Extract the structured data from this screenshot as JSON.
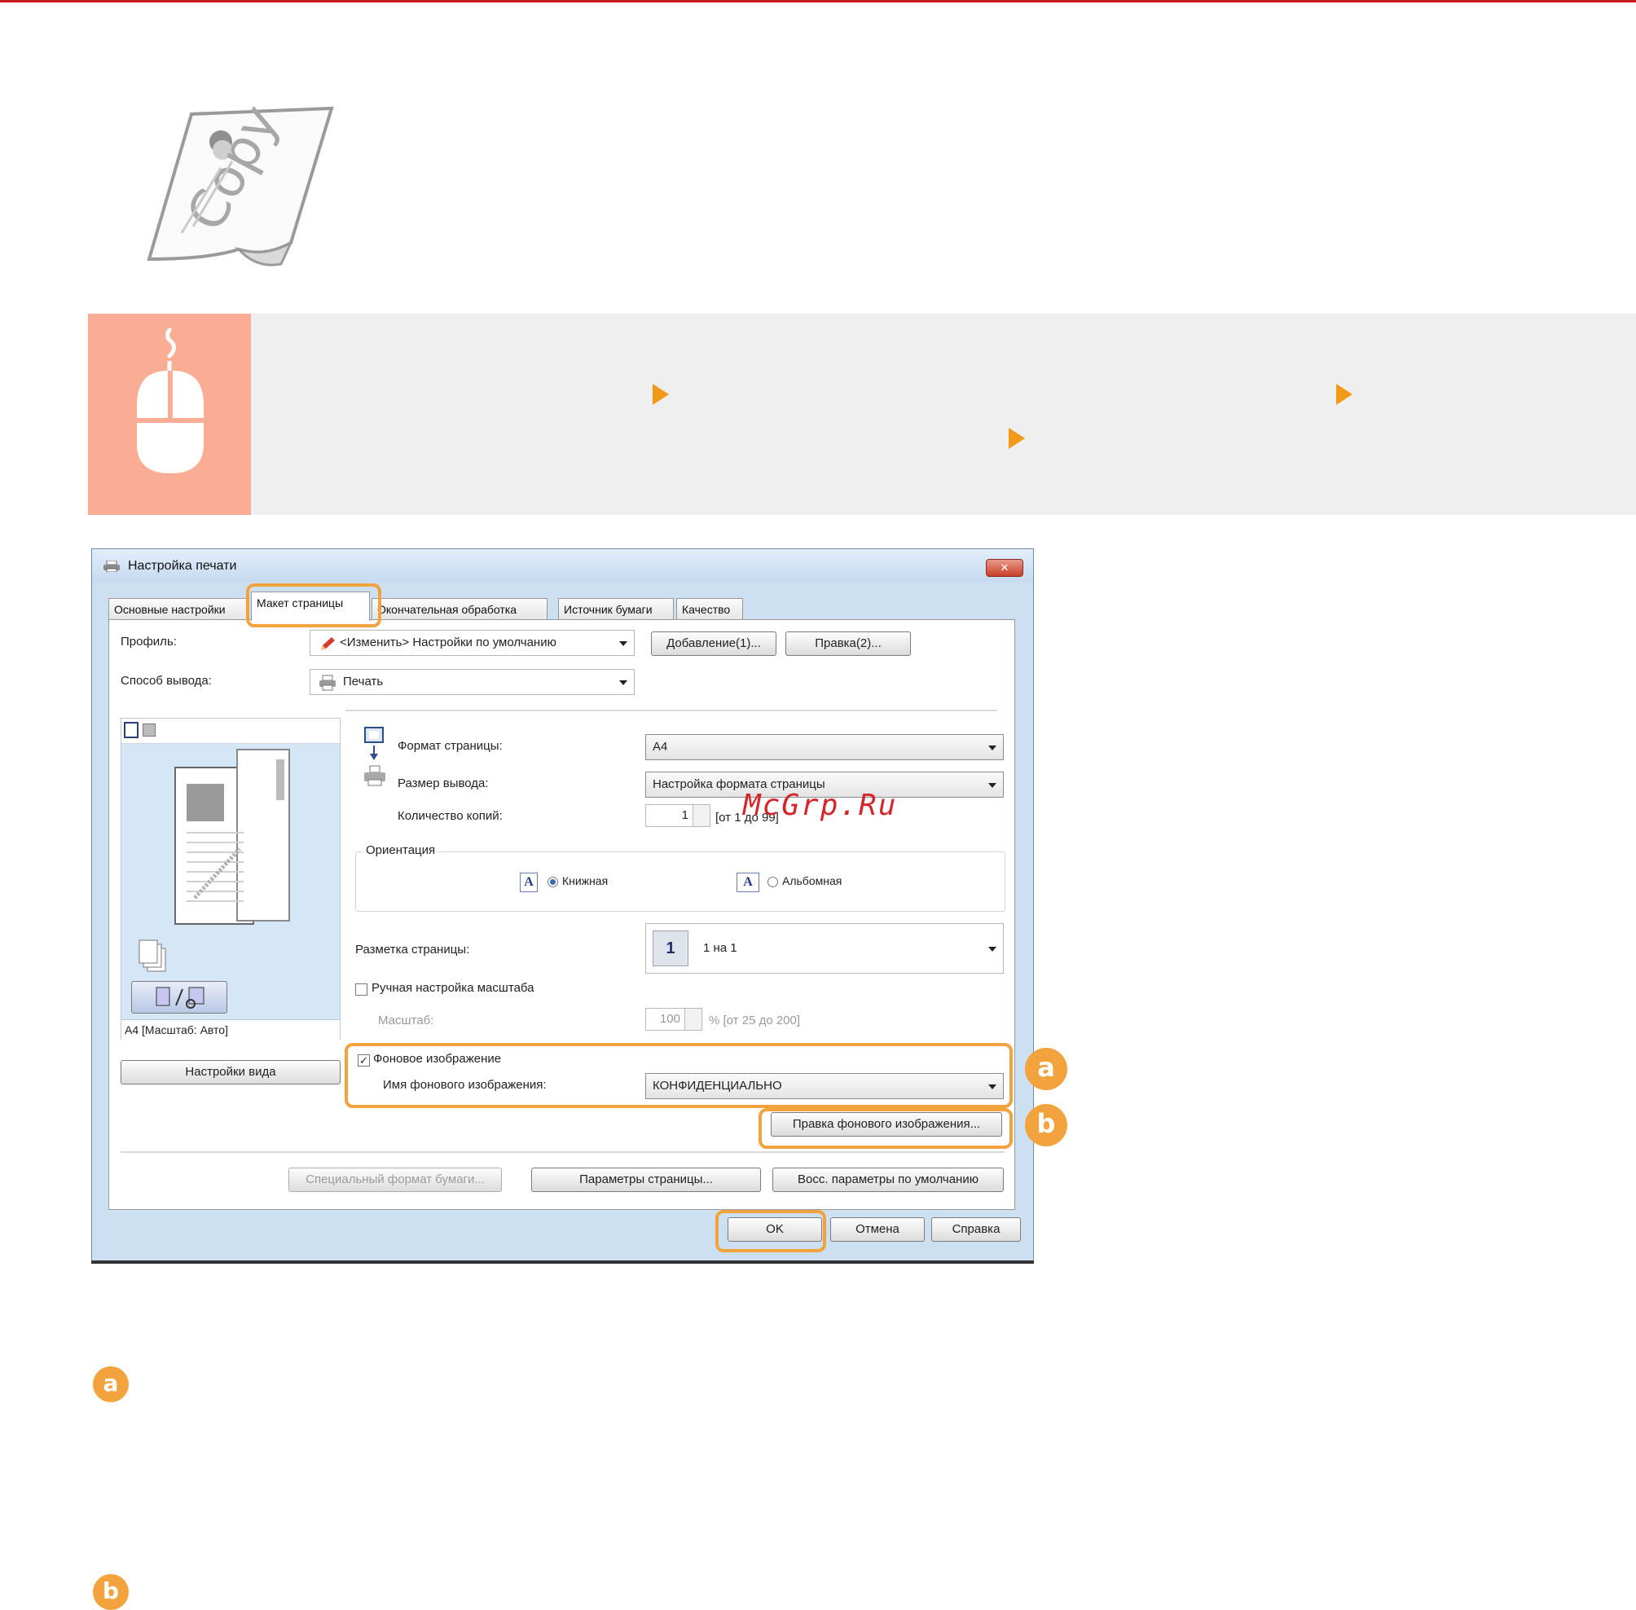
{
  "dialog": {
    "title": "Настройка печати",
    "close_label": "✕",
    "tabs": [
      "Основные настройки",
      "Макет страницы",
      "Окончательная обработка",
      "Источник бумаги",
      "Качество"
    ],
    "profile_label": "Профиль:",
    "profile_value": "<Изменить> Настройки по умолчанию",
    "add_button": "Добавление(1)...",
    "edit_button": "Правка(2)...",
    "output_label": "Способ вывода:",
    "output_value": "Печать",
    "preview_caption": "A4 [Масштаб: Авто]",
    "view_settings_button": "Настройки вида",
    "page_size_label": "Формат страницы:",
    "page_size_value": "A4",
    "output_size_label": "Размер вывода:",
    "output_size_value": "Настройка формата страницы",
    "copies_label": "Количество копий:",
    "copies_value": "1",
    "copies_range": "[от 1 до 99]",
    "orientation_label": "Ориентация",
    "portrait_label": "Книжная",
    "landscape_label": "Альбомная",
    "orient_glyph": "A",
    "layout_label": "Разметка страницы:",
    "layout_number": "1",
    "layout_value": "1 на 1",
    "manual_scale_label": "Ручная настройка масштаба",
    "scale_label": "Масштаб:",
    "scale_value": "100",
    "scale_range": "% [от 25 до 200]",
    "watermark_label": "Фоновое изображение",
    "watermark_checked": "✓",
    "watermark_name_label": "Имя фонового изображения:",
    "watermark_name_value": "КОНФИДЕНЦИАЛЬНО",
    "edit_watermark_button": "Правка фонового изображения...",
    "custom_paper_button": "Специальный формат бумаги...",
    "page_options_button": "Параметры страницы...",
    "restore_defaults_button": "Восс. параметры по умолчанию",
    "ok_button": "OK",
    "cancel_button": "Отмена",
    "help_button": "Справка"
  },
  "markers": {
    "a": "a",
    "b": "b"
  },
  "site_watermark": "McGrp.Ru",
  "colors": {
    "accent": "#f3a33e",
    "banner_icon": "#f8ad94",
    "arrow": "#f29a18",
    "top_rule": "#c8191e"
  },
  "icons": [
    "copy-document-icon",
    "mouse-icon",
    "printer-icon"
  ]
}
